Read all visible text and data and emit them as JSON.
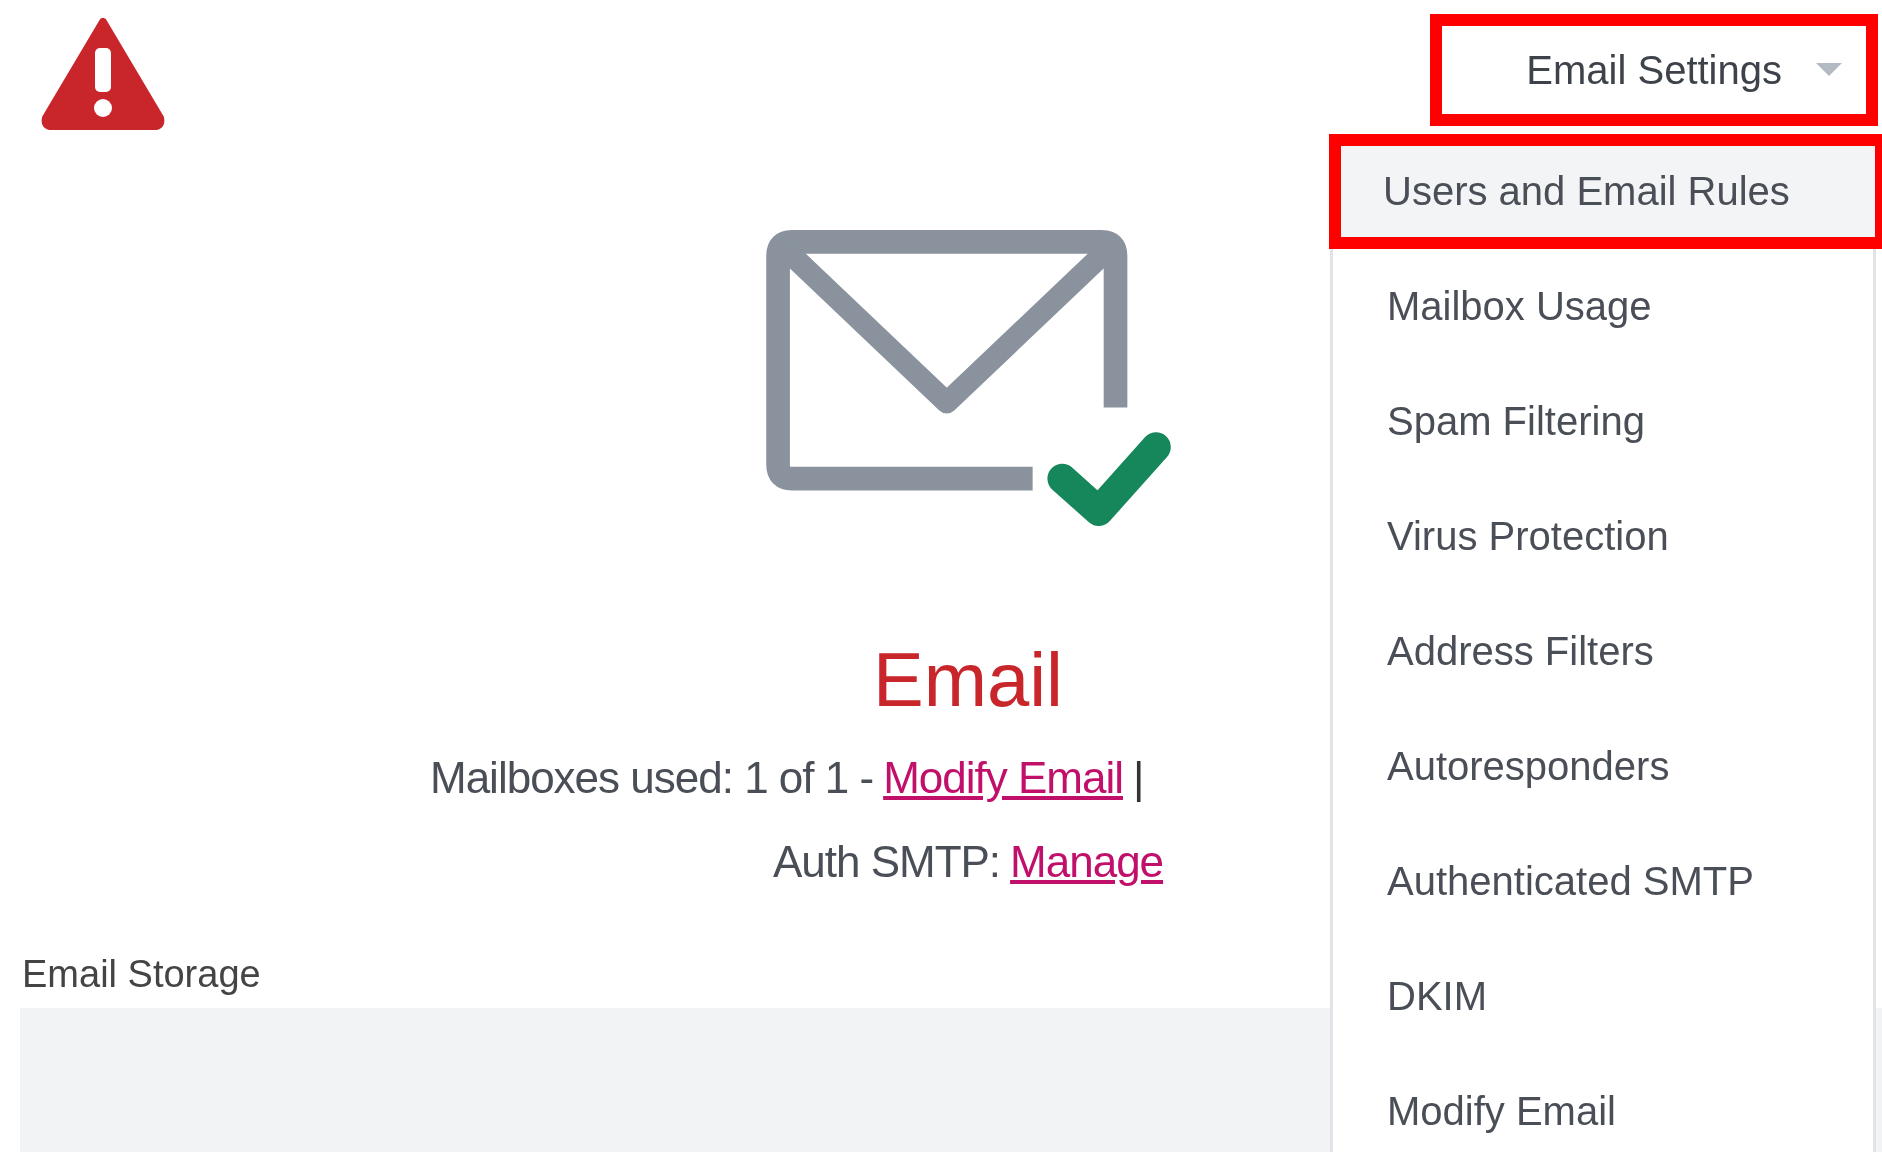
{
  "settings_button": {
    "label": "Email Settings",
    "annotated": true
  },
  "menu": {
    "items": [
      {
        "label": "Users and Email Rules",
        "selected": true,
        "annotated": true
      },
      {
        "label": "Mailbox Usage",
        "selected": false,
        "annotated": false
      },
      {
        "label": "Spam Filtering",
        "selected": false,
        "annotated": false
      },
      {
        "label": "Virus Protection",
        "selected": false,
        "annotated": false
      },
      {
        "label": "Address Filters",
        "selected": false,
        "annotated": false
      },
      {
        "label": "Autoresponders",
        "selected": false,
        "annotated": false
      },
      {
        "label": "Authenticated SMTP",
        "selected": false,
        "annotated": false
      },
      {
        "label": "DKIM",
        "selected": false,
        "annotated": false
      },
      {
        "label": "Modify Email",
        "selected": false,
        "annotated": false
      }
    ]
  },
  "title": "Email",
  "mailboxes": {
    "text": "Mailboxes used: 1 of 1 -",
    "link": "Modify Email",
    "separator": "|"
  },
  "auth_smtp": {
    "text": "Auth SMTP:",
    "link": "Manage"
  },
  "storage": {
    "label": "Email Storage"
  }
}
